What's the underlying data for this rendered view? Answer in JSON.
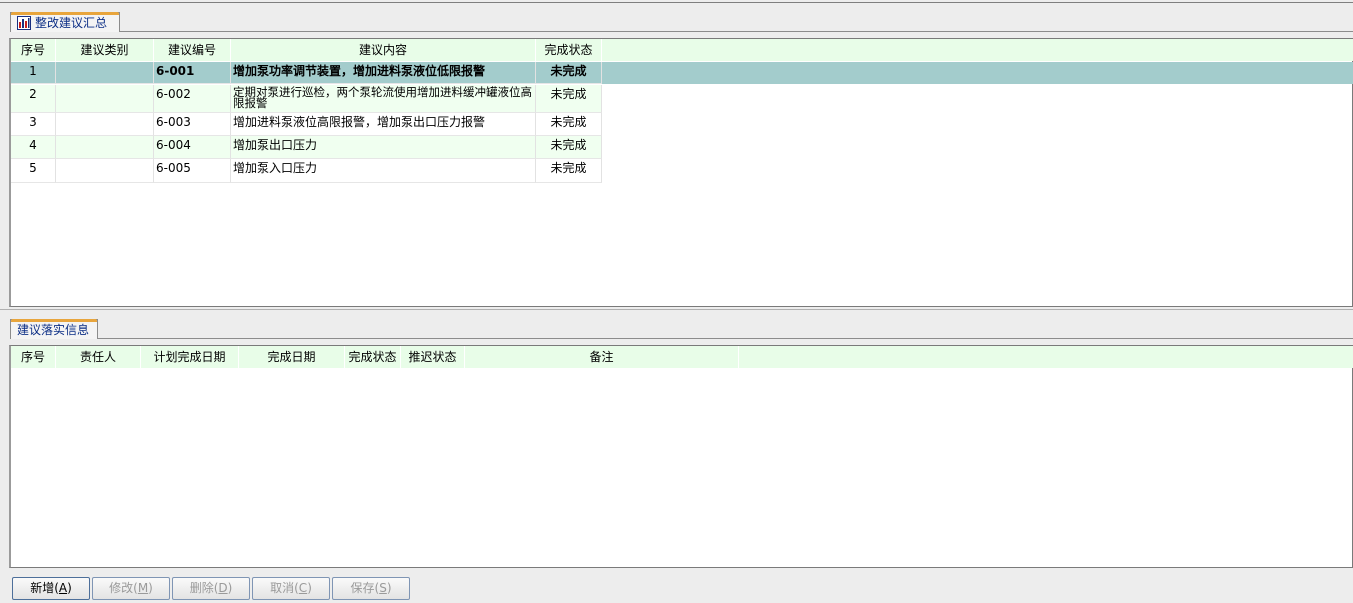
{
  "summary_tab": {
    "label": "整改建议汇总",
    "icon": "report-grid-icon"
  },
  "summary_table": {
    "columns": [
      "序号",
      "建议类别",
      "建议编号",
      "建议内容",
      "完成状态"
    ],
    "rows": [
      {
        "seq": "1",
        "category": "",
        "code": "6-001",
        "content": "增加泵功率调节装置，增加进料泵液位低限报警",
        "status": "未完成"
      },
      {
        "seq": "2",
        "category": "",
        "code": "6-002",
        "content": "定期对泵进行巡检，两个泵轮流使用增加进料缓冲罐液位高限报警",
        "status": "未完成"
      },
      {
        "seq": "3",
        "category": "",
        "code": "6-003",
        "content": "增加进料泵液位高限报警，增加泵出口压力报警",
        "status": "未完成"
      },
      {
        "seq": "4",
        "category": "",
        "code": "6-004",
        "content": "增加泵出口压力",
        "status": "未完成"
      },
      {
        "seq": "5",
        "category": "",
        "code": "6-005",
        "content": "增加泵入口压力",
        "status": "未完成"
      }
    ]
  },
  "detail_tab": {
    "label": "建议落实信息"
  },
  "detail_table": {
    "columns": [
      "序号",
      "责任人",
      "计划完成日期",
      "完成日期",
      "完成状态",
      "推迟状态",
      "备注"
    ]
  },
  "buttons": {
    "add": {
      "label": "新增(",
      "key": "A",
      "suffix": ")"
    },
    "edit": {
      "label": "修改(",
      "key": "M",
      "suffix": ")"
    },
    "delete": {
      "label": "删除(",
      "key": "D",
      "suffix": ")"
    },
    "cancel": {
      "label": "取消(",
      "key": "C",
      "suffix": ")"
    },
    "save": {
      "label": "保存(",
      "key": "S",
      "suffix": ")"
    }
  },
  "colors": {
    "header_bg": "#e8fde8",
    "selected_row_bg": "#a3cccc",
    "alt_row_bg": "#f0fff0",
    "tab_text": "#0d2f86",
    "tab_accent": "#e8a53c"
  }
}
